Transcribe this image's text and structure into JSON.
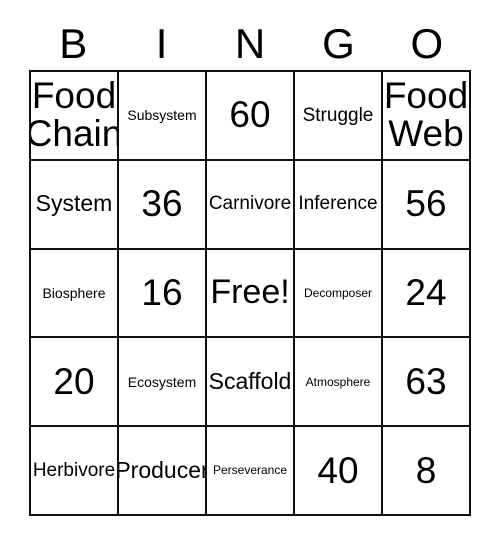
{
  "card": {
    "title": "BINGO",
    "header": {
      "letters": [
        "B",
        "I",
        "N",
        "G",
        "O"
      ]
    },
    "grid": {
      "columns": 5,
      "rows": 5,
      "border_color": "#111111",
      "background_color": "#ffffff",
      "text_color": "#000000",
      "free_space": {
        "row": 3,
        "column": 3,
        "label": "Free!"
      },
      "cells": [
        [
          {
            "text": "Food\nChain",
            "size": "xl"
          },
          {
            "text": "Subsystem",
            "size": "xs"
          },
          {
            "text": "60",
            "size": "xl"
          },
          {
            "text": "Struggle",
            "size": "sm"
          },
          {
            "text": "Food\nWeb",
            "size": "xl"
          }
        ],
        [
          {
            "text": "System",
            "size": "md"
          },
          {
            "text": "36",
            "size": "xl"
          },
          {
            "text": "Carnivore",
            "size": "sm"
          },
          {
            "text": "Inference",
            "size": "sm"
          },
          {
            "text": "56",
            "size": "xl"
          }
        ],
        [
          {
            "text": "Biosphere",
            "size": "xs"
          },
          {
            "text": "16",
            "size": "xl"
          },
          {
            "text": "Free!",
            "size": "lg"
          },
          {
            "text": "Decomposer",
            "size": "xxs"
          },
          {
            "text": "24",
            "size": "xl"
          }
        ],
        [
          {
            "text": "20",
            "size": "xl"
          },
          {
            "text": "Ecosystem",
            "size": "xs"
          },
          {
            "text": "Scaffold",
            "size": "md"
          },
          {
            "text": "Atmosphere",
            "size": "xxs"
          },
          {
            "text": "63",
            "size": "xl"
          }
        ],
        [
          {
            "text": "Herbivore",
            "size": "sm"
          },
          {
            "text": "Producer",
            "size": "md"
          },
          {
            "text": "Perseverance",
            "size": "xxs"
          },
          {
            "text": "40",
            "size": "xl"
          },
          {
            "text": "8",
            "size": "xl"
          }
        ]
      ]
    }
  }
}
